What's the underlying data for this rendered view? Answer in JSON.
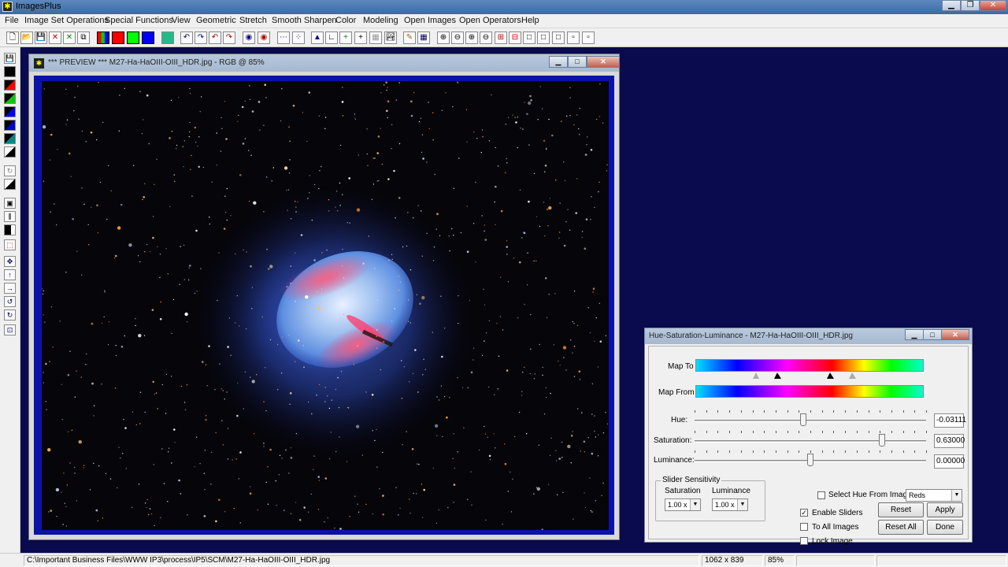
{
  "app": {
    "title": "ImagesPlus"
  },
  "menu": [
    "File",
    "Image Set Operations",
    "Special Functions",
    "View",
    "Geometric",
    "Stretch",
    "Smooth Sharpen",
    "Color",
    "Modeling",
    "Open Images",
    "Open Operators",
    "Help"
  ],
  "preview": {
    "title": "*** PREVIEW *** M27-Ha-HaOIII-OIII_HDR.jpg - RGB @ 85%"
  },
  "hsl": {
    "title": "Hue-Saturation-Luminance - M27-Ha-HaOIII-OIII_HDR.jpg",
    "map_to_label": "Map To",
    "map_from_label": "Map From",
    "hue_label": "Hue:",
    "hue_value": "-0.03111",
    "hue_level": 0.47,
    "saturation_label": "Saturation:",
    "saturation_value": "0.63000",
    "saturation_level": 0.81,
    "luminance_label": "Luminance:",
    "luminance_value": "0.00000",
    "luminance_level": 0.5,
    "slider_sensitivity_label": "Slider Sensitivity",
    "sens_saturation_label": "Saturation",
    "sens_luminance_label": "Luminance",
    "sens_saturation_value": "1.00 x",
    "sens_luminance_value": "1.00 x",
    "select_hue_label": "Select Hue From Image",
    "hue_range_value": "Reds",
    "enable_sliders_label": "Enable Sliders",
    "to_all_images_label": "To All Images",
    "lock_image_label": "Lock Image",
    "reset_label": "Reset",
    "apply_label": "Apply",
    "reset_all_label": "Reset All",
    "done_label": "Done"
  },
  "status": {
    "path": "C:\\Important Business Files\\WWW IP3\\process\\IP5\\SCM\\M27-Ha-HaOIII-OIII_HDR.jpg",
    "dimensions": "1062 x 839",
    "zoom": "85%"
  }
}
